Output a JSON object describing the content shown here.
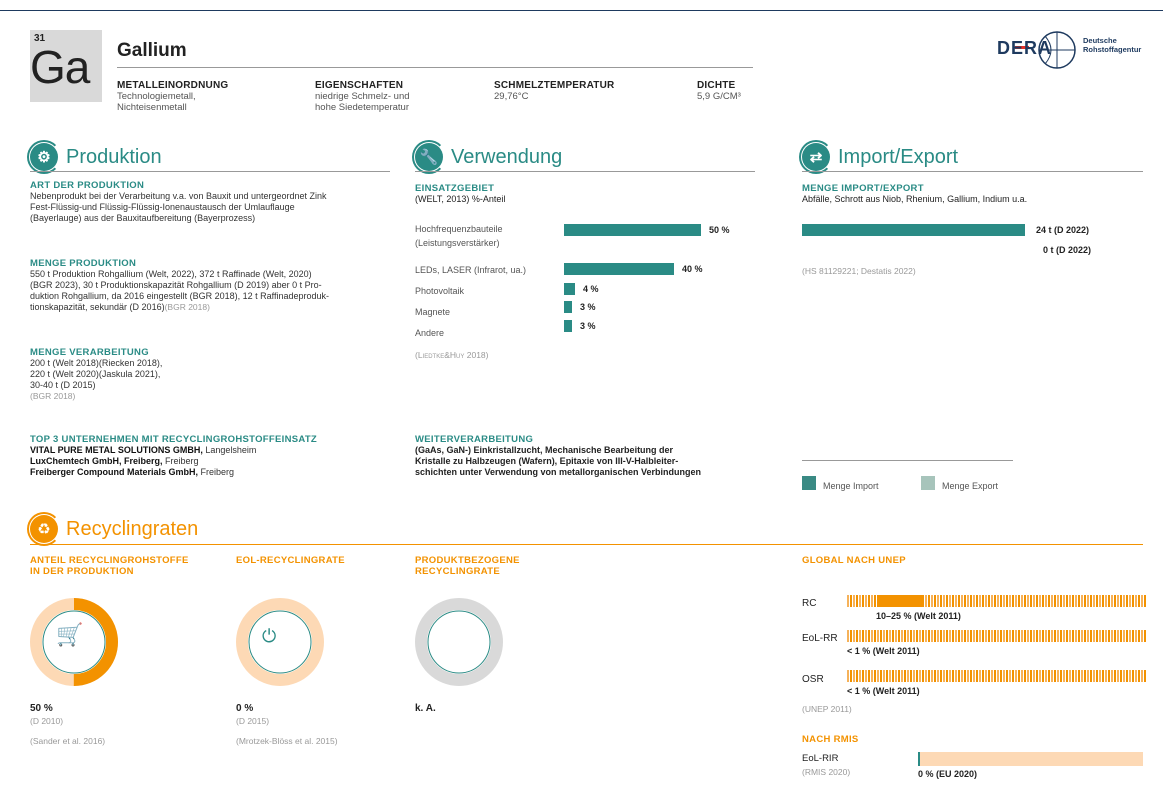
{
  "element": {
    "number": "31",
    "symbol": "Ga",
    "name": "Gallium"
  },
  "properties": [
    {
      "heading": "METALLEINORDNUNG",
      "lines": [
        "Technologiemetall,",
        "Nichteisenmetall"
      ]
    },
    {
      "heading": "EIGENSCHAFTEN",
      "lines": [
        "niedrige Schmelz- und",
        "hohe Siedetemperatur"
      ]
    },
    {
      "heading": "SCHMELZTEMPERATUR",
      "lines": [
        "29,76°C"
      ]
    },
    {
      "heading": "DICHTE",
      "lines": [
        "5,9 G/CM³"
      ]
    }
  ],
  "logo": {
    "text": "DERA",
    "sub1": "Deutsche",
    "sub2": "Rohstoffagentur"
  },
  "produktion": {
    "title": "Produktion",
    "art_heading": "ART DER PRODUKTION",
    "art_lines": [
      "Nebenprodukt bei der Verarbeitung v.a. von Bauxit und untergeordnet Zink",
      "Fest-Flüssig-und Flüssig-Flüssig-Ionenaustausch der Umlauflauge",
      "(Bayerlauge) aus der Bauxitaufbereitung (Bayerprozess)"
    ],
    "menge_heading": "MENGE PRODUKTION",
    "menge_lines": [
      "550 t Produktion Rohgallium (Welt, 2022), 372 t Raffinade (Welt, 2020)",
      "(BGR 2023), 30 t Produktionskapazität Rohgallium (D 2019) aber 0 t Pro-",
      "duktion Rohgallium, da 2016 eingestellt (BGR 2018), 12 t Raffinadeproduk-",
      "tionskapazität, sekundär (D 2016)"
    ],
    "menge_source": "(BGR 2018)",
    "verarb_heading": "MENGE VERARBEITUNG",
    "verarb_lines": [
      "200 t (Welt 2018)(Riecken 2018),",
      "220 t (Welt 2020)(Jaskula 2021),",
      "30-40 t (D 2015)"
    ],
    "verarb_source": "(BGR 2018)",
    "top3_heading": "TOP 3 UNTERNEHMEN MIT RECYCLINGROHSTOFFEINSATZ",
    "companies": [
      {
        "name": "VITAL PURE METAL SOLUTIONS GMBH,",
        "place": "Langelsheim"
      },
      {
        "name": "LuxChemtech GmbH, Freiberg,",
        "place": "Freiberg"
      },
      {
        "name": "Freiberger Compound Materials GmbH,",
        "place": "Freiberg"
      }
    ]
  },
  "verwendung": {
    "title": "Verwendung",
    "einsatz_heading": "EINSATZGEBIET",
    "einsatz_sub": "(WELT, 2013) %-Anteil",
    "bars": [
      {
        "label": "Hochfrequenzbauteile",
        "label2": "(Leistungsverstärker)",
        "value": 50,
        "text": "50 %"
      },
      {
        "label": "LEDs, LASER (Infrarot, ua.)",
        "label2": "",
        "value": 40,
        "text": "40 %"
      },
      {
        "label": "Photovoltaik",
        "label2": "",
        "value": 4,
        "text": "4 %"
      },
      {
        "label": "Magnete",
        "label2": "",
        "value": 3,
        "text": "3 %"
      },
      {
        "label": "Andere",
        "label2": "",
        "value": 3,
        "text": "3 %"
      }
    ],
    "source": "(Liedtke&Huy 2018)",
    "weiter_heading": "WEITERVERARBEITUNG",
    "weiter_lines": [
      "(GaAs, GaN-) Einkristallzucht, Mechanische Bearbeitung der",
      "Kristalle zu Halbzeugen (Wafern), Epitaxie von III-V-Halbleiter-",
      "schichten unter Verwendung von metallorganischen Verbindungen"
    ]
  },
  "import_export": {
    "title": "Import/Export",
    "heading": "MENGE IMPORT/EXPORT",
    "sub": "Abfälle, Schrott aus Niob, Rhenium, Gallium, Indium u.a.",
    "import_value": "24 t (D 2022)",
    "export_value": "0 t (D 2022)",
    "import_fraction": 1.0,
    "source": "(HS 81129221; Destatis 2022)",
    "legend_import": "Menge Import",
    "legend_export": "Menge Export",
    "color_import": "#3a8a84",
    "color_export": "#a7c4bb"
  },
  "recycling": {
    "title": "Recyclingraten",
    "col1_heading1": "ANTEIL RECYCLINGROHSTOFFE",
    "col1_heading2": "IN DER PRODUKTION",
    "col1_value": "50 %",
    "col1_fraction": 0.5,
    "col1_src1": "(D 2010)",
    "col1_src2": "(Sander et al. 2016)",
    "col2_heading": "EOL-RECYCLINGRATE",
    "col2_value": "0 %",
    "col2_fraction": 0,
    "col2_src1": "(D 2015)",
    "col2_src2": "(Mrotzek-Blöss et al. 2015)",
    "col3_heading1": "PRODUKTBEZOGENE",
    "col3_heading2": "RECYCLINGRATE",
    "col3_value": "k. A.",
    "unep_heading": "GLOBAL NACH UNEP",
    "unep_rows": [
      {
        "label": "RC",
        "text": "10–25 % (Welt 2011)"
      },
      {
        "label": "EoL-RR",
        "text": "< 1 % (Welt 2011)"
      },
      {
        "label": "OSR",
        "text": "< 1 % (Welt 2011)"
      }
    ],
    "unep_source": "(UNEP 2011)",
    "rmis_heading": "NACH RMIS",
    "rmis_label": "EoL-RIR",
    "rmis_source": "(RMIS 2020)",
    "rmis_value": "0 % (EU 2020)",
    "color_orange": "#f39200",
    "color_light": "#fdd9b5"
  }
}
